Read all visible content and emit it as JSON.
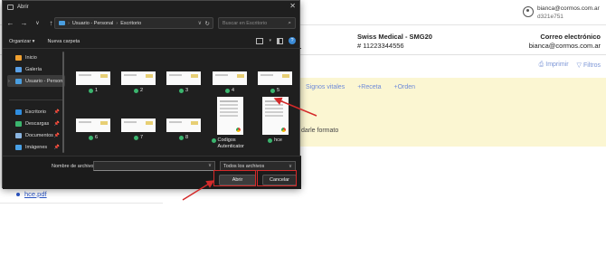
{
  "page": {
    "user": {
      "email": "bianca@cormos.com.ar",
      "id": "d321e751"
    },
    "insurance": {
      "name": "Swiss Medical - SMG20",
      "number": "# 11223344556"
    },
    "contact": {
      "heading": "Correo electrónico",
      "email": "bianca@cormos.com.ar"
    },
    "actions": {
      "print": "Imprimir",
      "filters": "Filtros"
    },
    "links": [
      "Signos vitales",
      "+Receta",
      "+Orden"
    ],
    "format_text": "darle formato",
    "file_link": "hce.pdf"
  },
  "dialog": {
    "title": "Abrir",
    "close": "✕",
    "nav": {
      "back": "←",
      "forward": "→",
      "dropdown": "∨",
      "up": "↑"
    },
    "path": [
      "Usuario - Personal",
      "Escritorio"
    ],
    "search_placeholder": "Buscar en Escritorio",
    "toolbar": {
      "organize": "Organizar ▾",
      "new_folder": "Nueva carpeta",
      "help": "?"
    },
    "sidebar": [
      {
        "label": "Inicio",
        "icon": "home-icon",
        "color": "#f0a030"
      },
      {
        "label": "Galería",
        "icon": "gallery-icon",
        "color": "#5aa0e6"
      },
      {
        "label": "Usuario - Person",
        "icon": "folder-icon",
        "color": "#4a9ee0"
      },
      {
        "label": "Escritorio",
        "icon": "desktop-icon",
        "color": "#2f8de0"
      },
      {
        "label": "Descargas",
        "icon": "download-icon",
        "color": "#3bb56e"
      },
      {
        "label": "Documentos",
        "icon": "documents-icon",
        "color": "#8ab4e0"
      },
      {
        "label": "Imágenes",
        "icon": "images-icon",
        "color": "#48a0e6"
      }
    ],
    "files": [
      {
        "name": "1",
        "type": "image"
      },
      {
        "name": "2",
        "type": "image"
      },
      {
        "name": "3",
        "type": "image"
      },
      {
        "name": "4",
        "type": "image"
      },
      {
        "name": "5",
        "type": "image"
      },
      {
        "name": "6",
        "type": "image"
      },
      {
        "name": "7",
        "type": "image"
      },
      {
        "name": "8",
        "type": "image"
      },
      {
        "name": "Codigos Autenticator",
        "type": "pdf"
      },
      {
        "name": "hce",
        "type": "pdf"
      }
    ],
    "filename_label": "Nombre de archivo:",
    "filename_value": "",
    "filter": "Todos los archivos",
    "open_label": "Abrir",
    "cancel_label": "Cancelar"
  },
  "colors": {
    "dialog_bg": "#1f1f1f",
    "highlight": "#d42a2a",
    "banner": "#fbf6d2",
    "link": "#6d8ad9"
  }
}
